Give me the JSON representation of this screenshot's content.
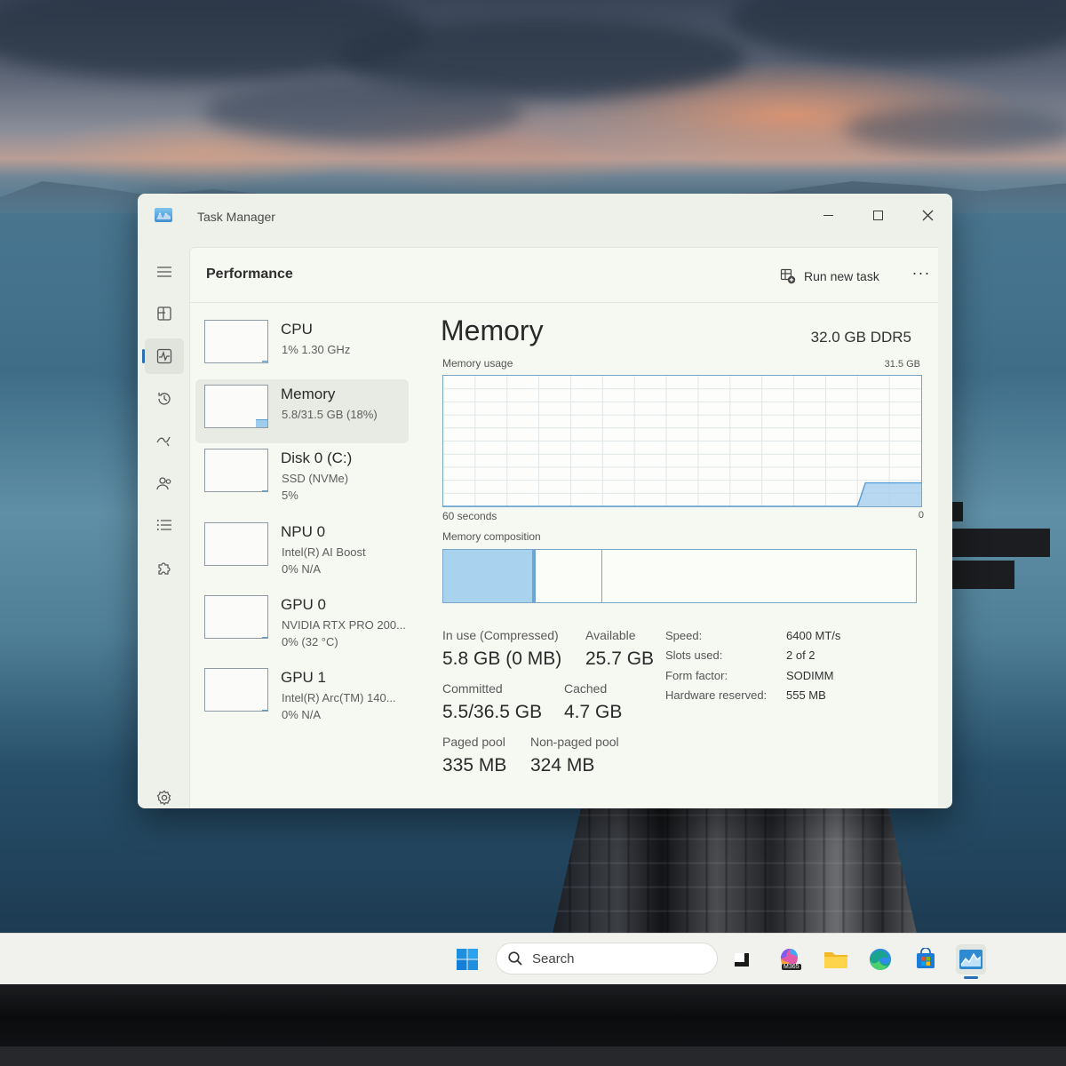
{
  "window": {
    "title": "Task Manager"
  },
  "header": {
    "page_title": "Performance",
    "run_new_task": "Run new task",
    "more": "···"
  },
  "devices": [
    {
      "name": "CPU",
      "sub": "1%  1.30 GHz",
      "sub2": "",
      "fill_fraction": 0.05
    },
    {
      "name": "Memory",
      "sub": "5.8/31.5 GB (18%)",
      "sub2": "",
      "fill_fraction": 0.18
    },
    {
      "name": "Disk 0 (C:)",
      "sub": "SSD (NVMe)",
      "sub2": "5%",
      "fill_fraction": 0.02
    },
    {
      "name": "NPU 0",
      "sub": "Intel(R) AI Boost",
      "sub2": "0%  N/A",
      "fill_fraction": 0
    },
    {
      "name": "GPU 0",
      "sub": "NVIDIA RTX PRO 200...",
      "sub2": "0%  (32 °C)",
      "fill_fraction": 0.02
    },
    {
      "name": "GPU 1",
      "sub": "Intel(R) Arc(TM) 140...",
      "sub2": "0%  N/A",
      "fill_fraction": 0.02
    }
  ],
  "memory": {
    "title": "Memory",
    "spec": "32.0 GB DDR5",
    "usage_label": "Memory usage",
    "usage_max": "31.5 GB",
    "time_label": "60 seconds",
    "min_label": "0",
    "composition_label": "Memory composition",
    "composition": {
      "in_use_fraction": 0.19,
      "modified_fraction": 0.006,
      "standby_fraction": 0.14,
      "free_fraction": 0.664
    },
    "usage_history_fraction": [
      0,
      0,
      0,
      0,
      0,
      0,
      0,
      0,
      0,
      0,
      0,
      0,
      0,
      0,
      0,
      0,
      0,
      0,
      0,
      0,
      0,
      0,
      0,
      0,
      0,
      0,
      0,
      0,
      0,
      0,
      0,
      0,
      0,
      0,
      0,
      0,
      0,
      0,
      0,
      0,
      0,
      0,
      0,
      0,
      0,
      0,
      0,
      0,
      0,
      0,
      0,
      0,
      0,
      0.18,
      0.18,
      0.18,
      0.18,
      0.18,
      0.18,
      0.18,
      0.18
    ],
    "stats": {
      "in_use_label": "In use (Compressed)",
      "in_use_value": "5.8 GB (0 MB)",
      "available_label": "Available",
      "available_value": "25.7 GB",
      "committed_label": "Committed",
      "committed_value": "5.5/36.5 GB",
      "cached_label": "Cached",
      "cached_value": "4.7 GB",
      "paged_label": "Paged pool",
      "paged_value": "335 MB",
      "nonpaged_label": "Non-paged pool",
      "nonpaged_value": "324 MB"
    },
    "specs": [
      {
        "label": "Speed:",
        "value": "6400 MT/s"
      },
      {
        "label": "Slots used:",
        "value": "2 of 2"
      },
      {
        "label": "Form factor:",
        "value": "SODIMM"
      },
      {
        "label": "Hardware reserved:",
        "value": "555 MB"
      }
    ]
  },
  "taskbar": {
    "search_placeholder": "Search",
    "m365_badge": "M365"
  },
  "colors": {
    "accent": "#2a6fb5",
    "memory_fill": "#9fcbec",
    "memory_line": "#5a9fd4"
  }
}
